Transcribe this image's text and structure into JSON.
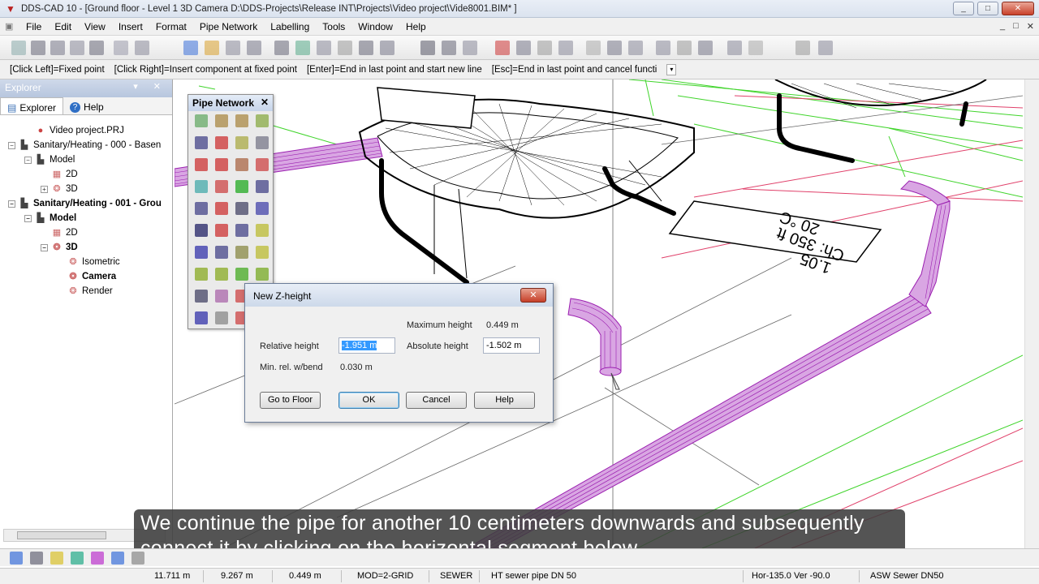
{
  "window": {
    "title": "DDS-CAD 10 - [Ground floor - Level 1  3D  Camera  D:\\DDS-Projects\\Release INT\\Projects\\Video project\\Vide8001.BIM* ]",
    "minimize": "_",
    "maximize": "□",
    "close": "✕"
  },
  "menu": {
    "items": [
      "File",
      "Edit",
      "View",
      "Insert",
      "Format",
      "Pipe Network",
      "Labelling",
      "Tools",
      "Window",
      "Help"
    ],
    "mdi_min": "_",
    "mdi_max": "□",
    "mdi_close": "✕"
  },
  "hints": {
    "items": [
      "[Click Left]=Fixed point",
      "[Click Right]=Insert component at fixed point",
      "[Enter]=End in last point and start new line",
      "[Esc]=End in last point and cancel functi"
    ],
    "arrow": "▾"
  },
  "explorer": {
    "title": "Explorer",
    "tabs": [
      "Explorer",
      "Help"
    ],
    "tree": [
      {
        "label": "Video project.PRJ",
        "icon": "project-icon",
        "depth": 1,
        "expander": ""
      },
      {
        "label": "Sanitary/Heating - 000 - Basen",
        "icon": "building-icon",
        "depth": 0,
        "expander": "−"
      },
      {
        "label": "Model",
        "icon": "model-icon",
        "depth": 1,
        "expander": "−"
      },
      {
        "label": "2D",
        "icon": "2d-view-icon",
        "depth": 2,
        "expander": ""
      },
      {
        "label": "3D",
        "icon": "3d-view-icon",
        "depth": 2,
        "expander": "+"
      },
      {
        "label": "Sanitary/Heating - 001 - Grou",
        "icon": "building-icon",
        "depth": 0,
        "expander": "−",
        "bold": true
      },
      {
        "label": "Model",
        "icon": "model-icon",
        "depth": 1,
        "expander": "−",
        "bold": true
      },
      {
        "label": "2D",
        "icon": "2d-view-icon",
        "depth": 2,
        "expander": ""
      },
      {
        "label": "3D",
        "icon": "3d-view-icon",
        "depth": 2,
        "expander": "−",
        "bold": true
      },
      {
        "label": "Isometric",
        "icon": "isometric-icon",
        "depth": 3,
        "expander": ""
      },
      {
        "label": "Camera",
        "icon": "camera-icon",
        "depth": 3,
        "expander": "",
        "bold": true
      },
      {
        "label": "Render",
        "icon": "render-icon",
        "depth": 3,
        "expander": ""
      }
    ]
  },
  "palette": {
    "title": "Pipe Network",
    "close": "✕"
  },
  "dialog": {
    "title": "New Z-height",
    "close": "✕",
    "max_height_label": "Maximum height",
    "max_height_value": "0.449 m",
    "rel_height_label": "Relative height",
    "rel_height_value": "-1.951 m",
    "abs_height_label": "Absolute height",
    "abs_height_value": "-1.502 m",
    "min_rel_label": "Min. rel. w/bend",
    "min_rel_value": "0.030 m",
    "buttons": {
      "go_to_floor": "Go to Floor",
      "ok": "OK",
      "cancel": "Cancel",
      "help": "Help"
    }
  },
  "drawing": {
    "room_label_lines": [
      "1.05",
      "Ch: 350 ft",
      "20 °C"
    ]
  },
  "subtitle": {
    "line1": "We continue the pipe for another 10 centimeters downwards and subsequently",
    "line2": "connect it by clicking on the horizontal segment below."
  },
  "statusbar": {
    "x": "11.711 m",
    "y": "9.267 m",
    "z": "0.449 m",
    "mode": "MOD=2-GRID",
    "system": "SEWER",
    "component": "HT sewer pipe DN 50",
    "view": "Hor-135.0 Ver -90.0",
    "pipe": "ASW Sewer DN50"
  },
  "colors": {
    "pipe": "#9b1fb0",
    "wire_green": "#3fd42a",
    "wire_red": "#e0406a",
    "wire_black": "#000000"
  }
}
